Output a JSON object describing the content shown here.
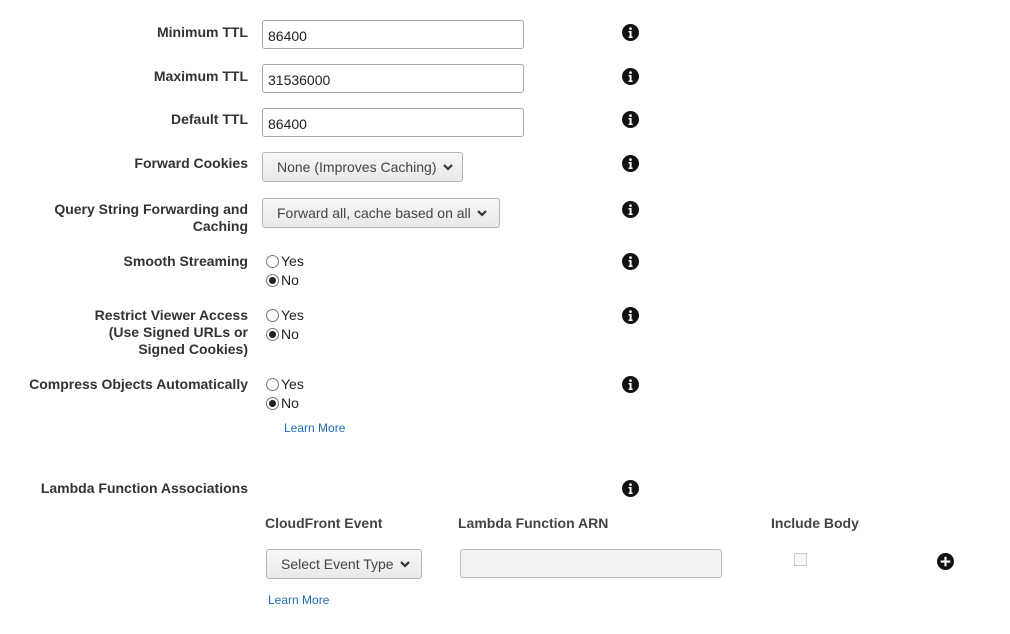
{
  "fields": {
    "min_ttl": {
      "label": "Minimum TTL",
      "value": "86400"
    },
    "max_ttl": {
      "label": "Maximum TTL",
      "value": "31536000"
    },
    "default_ttl": {
      "label": "Default TTL",
      "value": "86400"
    },
    "forward_cookies": {
      "label": "Forward Cookies",
      "selected": "None (Improves Caching)"
    },
    "query_string": {
      "label_line1": "Query String Forwarding and",
      "label_line2": "Caching",
      "selected": "Forward all, cache based on all"
    },
    "smooth_streaming": {
      "label": "Smooth Streaming",
      "yes": "Yes",
      "no": "No",
      "value": "No"
    },
    "restrict_viewer": {
      "label_line1": "Restrict Viewer Access",
      "label_line2": "(Use Signed URLs or",
      "label_line3": "Signed Cookies)",
      "yes": "Yes",
      "no": "No",
      "value": "No"
    },
    "compress": {
      "label": "Compress Objects Automatically",
      "yes": "Yes",
      "no": "No",
      "value": "No",
      "learn_more": "Learn More"
    }
  },
  "lambda": {
    "label": "Lambda Function Associations",
    "columns": {
      "event": "CloudFront Event",
      "arn": "Lambda Function ARN",
      "include_body": "Include Body"
    },
    "event_select": "Select Event Type",
    "arn_value": "",
    "include_body_checked": false,
    "learn_more": "Learn More"
  },
  "icons": {
    "info": "info-icon",
    "add": "plus-circle-icon",
    "dropdown": "chevron-down-icon"
  },
  "colors": {
    "link": "#1f6db8",
    "icon": "#111111"
  }
}
